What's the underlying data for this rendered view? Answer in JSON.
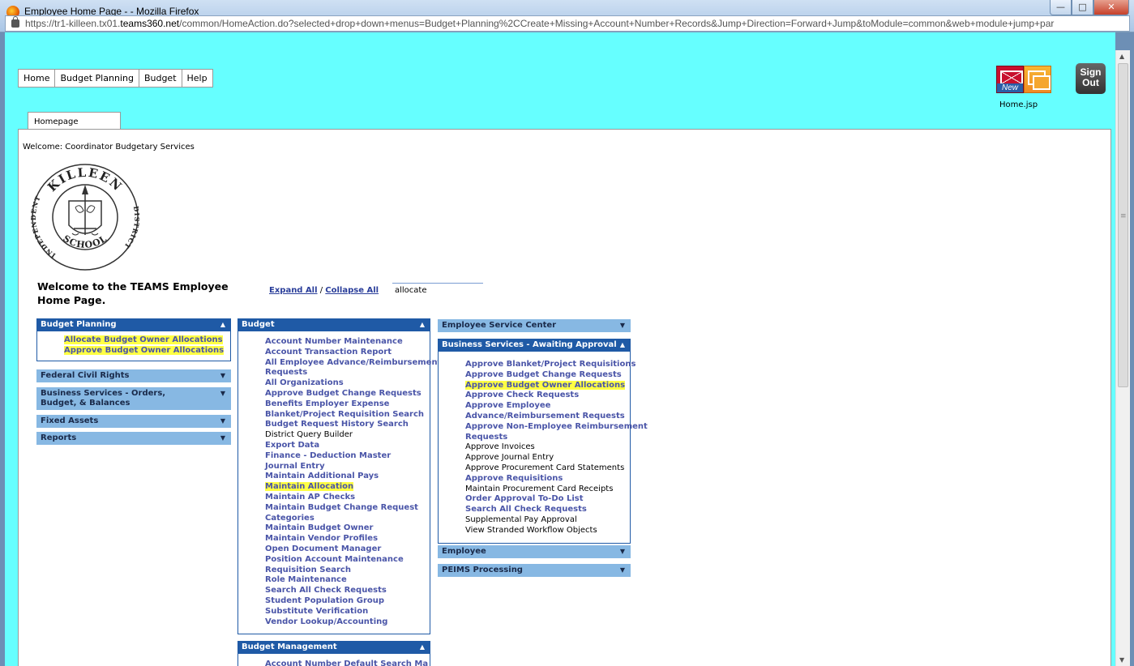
{
  "window": {
    "title": "Employee Home Page - - Mozilla Firefox",
    "url_prefix": "https://tr1-killeen.tx01.",
    "url_domain": "teams360.net",
    "url_suffix": "/common/HomeAction.do?selected+drop+down+menus=Budget+Planning%2CCreate+Missing+Account+Number+Records&Jump+Direction=Forward+Jump&toModule=common&web+module+jump+par"
  },
  "topmenu": [
    "Home",
    "Budget Planning",
    "Budget",
    "Help"
  ],
  "toolbar": {
    "mail_new_label": "New",
    "home_jsp": "Home.jsp",
    "signout_line1": "Sign",
    "signout_line2": "Out"
  },
  "tab": {
    "label": "Homepage"
  },
  "welcome_user": "Welcome: Coordinator Budgetary Services",
  "seal": {
    "top_text": "KILLEEN",
    "left_text": "INDEPENDENT",
    "right_text": "DISTRICT",
    "bottom_text": "SCHOOL"
  },
  "welcome_heading": "Welcome to the TEAMS Employee Home Page.",
  "expand_all": "Expand All",
  "separator": "/",
  "collapse_all": "Collapse All",
  "search": {
    "value": "allocate"
  },
  "col1": {
    "budget_planning": {
      "title": "Budget Planning",
      "items": [
        "Allocate Budget Owner Allocations",
        "Approve Budget Owner Allocations"
      ]
    },
    "federal_civil_rights": "Federal Civil Rights",
    "business_orders": "Business Services - Orders, Budget, & Balances",
    "fixed_assets": "Fixed Assets",
    "reports": "Reports"
  },
  "col2": {
    "budget": {
      "title": "Budget",
      "items": [
        "Account Number Maintenance",
        "Account Transaction Report",
        "All Employee Advance/Reimbursement",
        "Requests",
        "All Organizations",
        "Approve Budget Change Requests",
        "Benefits Employer Expense",
        "Blanket/Project Requisition Search",
        "Budget Request History Search",
        "District Query Builder",
        "Export Data",
        "Finance - Deduction Master",
        "Journal Entry",
        "Maintain Additional Pays",
        "Maintain Allocation",
        "Maintain AP Checks",
        "Maintain Budget Change Request",
        "Categories",
        "Maintain Budget Owner",
        "Maintain Vendor Profiles",
        "Open Document Manager",
        "Position Account Maintenance",
        "Requisition Search",
        "Role Maintenance",
        "Search All Check Requests",
        "Student Population Group",
        "Substitute Verification",
        "Vendor Lookup/Accounting"
      ]
    },
    "budget_management": "Budget Management",
    "budget_management_cut_item": "Account Number Default Search Ma"
  },
  "col3": {
    "employee_service_center": "Employee Service Center",
    "business_awaiting": {
      "title": "Business Services - Awaiting Approval",
      "items": [
        "Approve Blanket/Project Requisitions",
        "Approve Budget Change Requests",
        "Approve Budget Owner Allocations",
        "Approve Check Requests",
        "Approve Employee",
        "Advance/Reimbursement Requests",
        "Approve Non-Employee Reimbursement",
        "Requests",
        "Approve Invoices",
        "Approve Journal Entry",
        "Approve Procurement Card Statements",
        "Approve Requisitions",
        "Maintain Procurement Card Receipts",
        "Order Approval To-Do List",
        "Search All Check Requests",
        "Supplemental Pay Approval",
        "View Stranded Workflow Objects"
      ]
    },
    "employee": "Employee",
    "peims": "PEIMS Processing"
  },
  "colors": {
    "viewport_bg": "#66ffff",
    "header_dark": "#1f5aa6",
    "header_light": "#87b8e3",
    "link": "#4a55a8",
    "highlight": "#ffff44"
  }
}
